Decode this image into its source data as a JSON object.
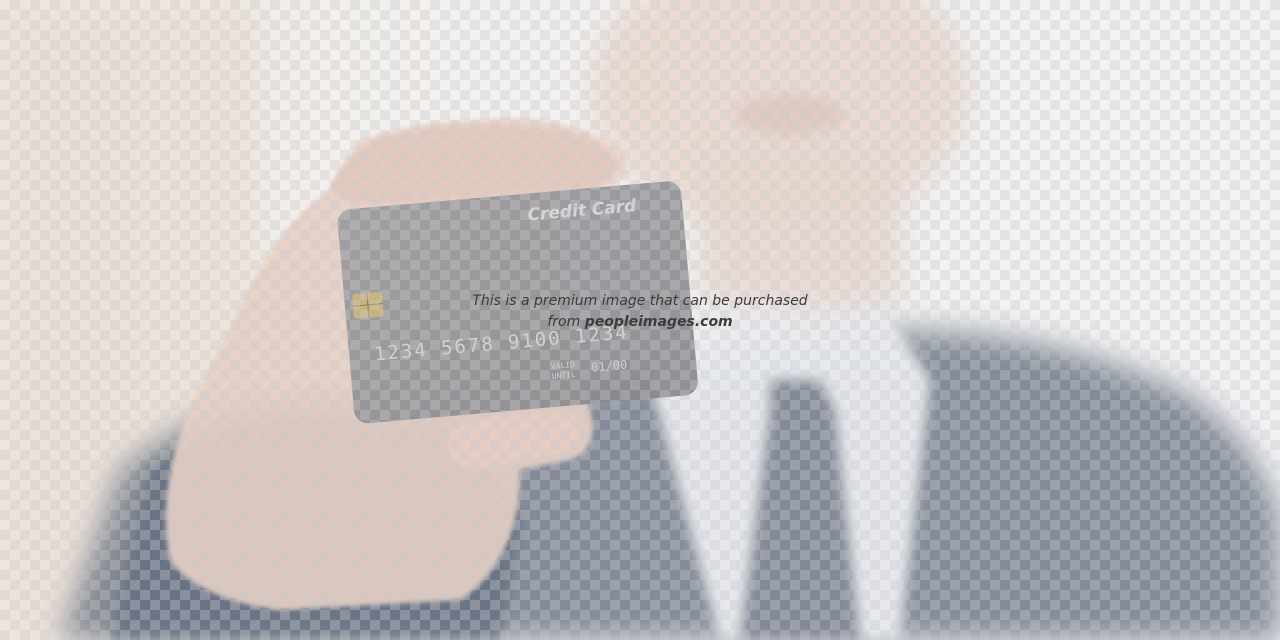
{
  "image": {
    "subject": "man in suit holding credit card toward camera",
    "card": {
      "brand_text": "Credit Card",
      "number_groups": [
        "1234",
        "5678",
        "9100",
        "1234"
      ],
      "valid_label": "VALID UNTIL",
      "expiry": "01/00"
    }
  },
  "watermark": {
    "line1": "This is a premium image that can be purchased",
    "line2_prefix": "from ",
    "line2_site": "peopleimages.com"
  },
  "colors": {
    "background": "#f4f4f4",
    "suit": "#5b6779",
    "shirt": "#e9e9ec",
    "skin": "#e5cfc3",
    "card": "#8b8b8f"
  }
}
